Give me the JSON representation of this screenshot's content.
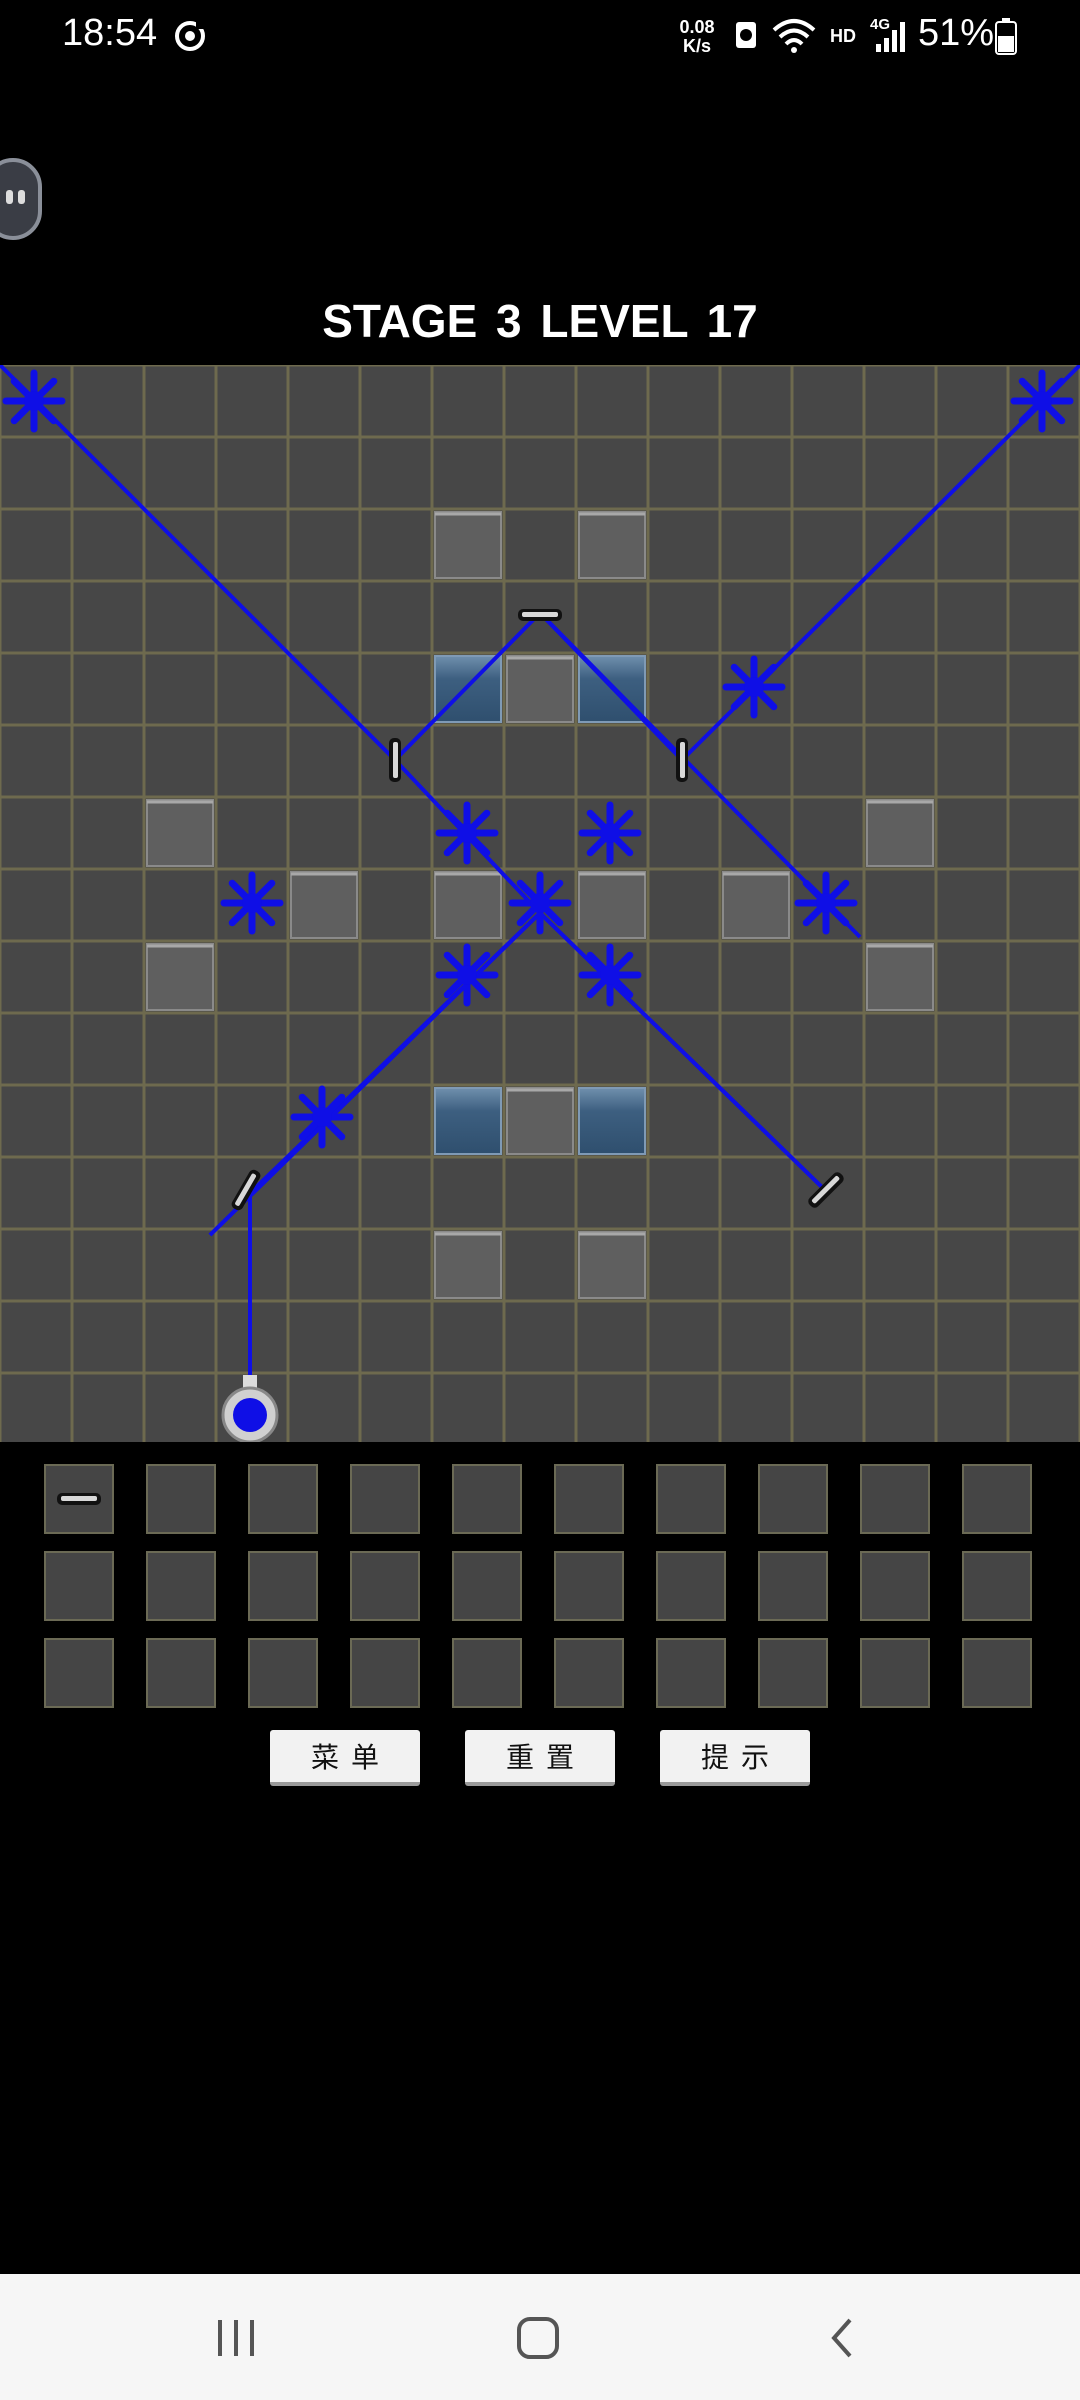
{
  "status_bar": {
    "time": "18:54",
    "net_speed_value": "0.08",
    "net_speed_unit": "K/s",
    "network_label": "HD",
    "signal_label": "4G",
    "battery": "51%"
  },
  "header": {
    "title": "STAGE 3  LEVEL 17"
  },
  "board": {
    "columns": 15,
    "rows": 15,
    "colors": {
      "cell": "#474747",
      "grid_line": "#6e6a4e",
      "laser": "#0f0fe6",
      "wall": "#5f5f5f",
      "glass": "#3f6283"
    },
    "laser_source_icon": "laser-emitter-icon",
    "mirror_icon": "mirror-icon",
    "target_icon": "star-target-icon"
  },
  "inventory": {
    "columns": 10,
    "rows": 3,
    "items": [
      {
        "slot": 0,
        "icon": "mirror-icon"
      }
    ]
  },
  "buttons": {
    "menu": "菜单",
    "reset": "重置",
    "hint": "提示"
  },
  "nav": {
    "recents_icon": "recents-icon",
    "home_icon": "home-icon",
    "back_icon": "back-icon"
  }
}
